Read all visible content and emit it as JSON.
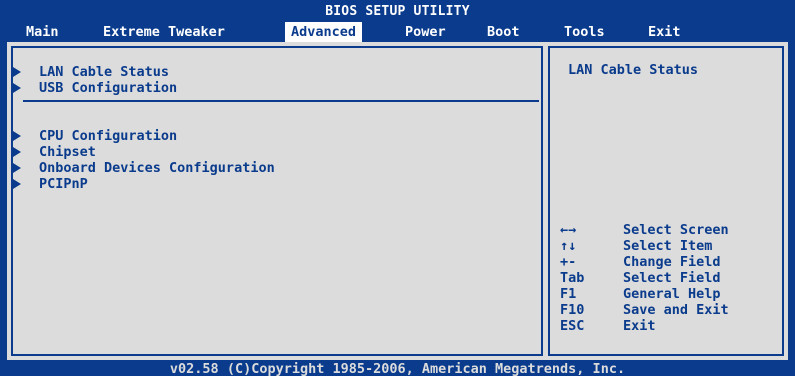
{
  "title": "BIOS SETUP UTILITY",
  "menu": [
    {
      "label": "Main",
      "active": false
    },
    {
      "label": "Extreme Tweaker",
      "active": false
    },
    {
      "label": "Advanced",
      "active": true
    },
    {
      "label": "Power",
      "active": false
    },
    {
      "label": "Boot",
      "active": false
    },
    {
      "label": "Tools",
      "active": false
    },
    {
      "label": "Exit",
      "active": false
    }
  ],
  "left_group_1": [
    {
      "label": "LAN Cable Status"
    },
    {
      "label": "USB Configuration"
    }
  ],
  "left_group_2": [
    {
      "label": "CPU Configuration"
    },
    {
      "label": "Chipset"
    },
    {
      "label": "Onboard Devices Configuration"
    },
    {
      "label": "PCIPnP"
    }
  ],
  "help": {
    "title": "LAN Cable Status"
  },
  "keys": [
    {
      "key": "←→",
      "action": "Select Screen"
    },
    {
      "key": "↑↓",
      "action": "Select Item"
    },
    {
      "key": "+-",
      "action": "Change Field"
    },
    {
      "key": "Tab",
      "action": "Select Field"
    },
    {
      "key": "F1",
      "action": "General Help"
    },
    {
      "key": "F10",
      "action": "Save and Exit"
    },
    {
      "key": "ESC",
      "action": "Exit"
    }
  ],
  "footer": "v02.58 (C)Copyright 1985-2006, American Megatrends, Inc.",
  "colors": {
    "background": "#0a3b8c",
    "panel": "#dcdcdc",
    "text_on_blue": "#ffffff",
    "text_on_panel": "#0a3b8c"
  }
}
